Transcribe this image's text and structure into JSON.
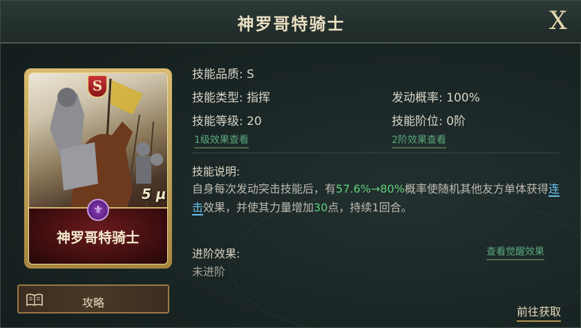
{
  "title": "神罗哥特骑士",
  "close_label": "X",
  "card": {
    "grade": "S",
    "name": "神罗哥特骑士",
    "art_tag": "5 μ"
  },
  "strategy_button": "攻略",
  "skill": {
    "quality": "技能品质: S",
    "type": "技能类型: 指挥",
    "level": "技能等级: 20",
    "level_effect_link": "1级效果查看",
    "trigger_rate": "发动概率: 100%",
    "rank": "技能阶位: 0阶",
    "rank_effect_link": "2阶效果查看"
  },
  "description": {
    "title": "技能说明:",
    "part1": "自身每次发动突击技能后，有",
    "highlight1": "57.6%→80%",
    "part2": "概率使随机其他友方单体获得",
    "link_word": "连击",
    "part3": "效果，并使其力量增加",
    "highlight2": "30",
    "part4": "点，持续1回合。"
  },
  "advance": {
    "title": "进阶效果:",
    "value": "未进阶",
    "awaken_link": "查看觉醒效果"
  },
  "goto_button": "前往获取",
  "colors": {
    "highlight_green": "#5fd07a",
    "link_blue": "#6ec3f0",
    "link_green": "#5aa87c",
    "gold": "#d8bb70"
  }
}
